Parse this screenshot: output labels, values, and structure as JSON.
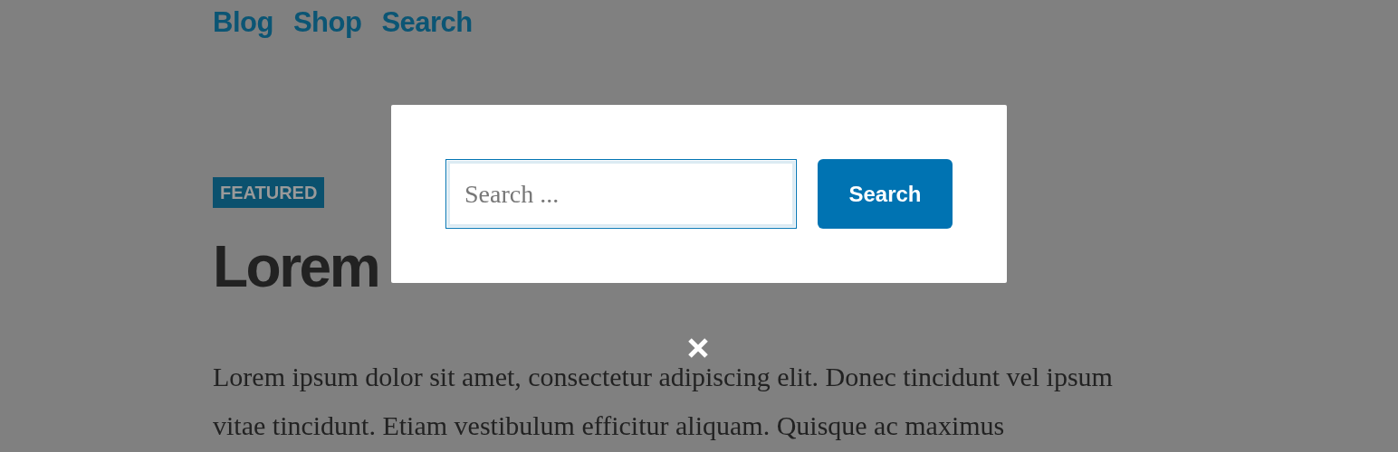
{
  "nav": [
    {
      "label": "Blog"
    },
    {
      "label": "Shop"
    },
    {
      "label": "Search"
    }
  ],
  "post": {
    "badge": "FEATURED",
    "title": "Lorem",
    "excerpt": "Lorem ipsum dolor sit amet, consectetur adipiscing elit. Donec tincidunt vel ipsum vitae tincidunt. Etiam vestibulum efficitur aliquam. Quisque ac maximus"
  },
  "search_modal": {
    "placeholder": "Search ...",
    "button": "Search"
  }
}
